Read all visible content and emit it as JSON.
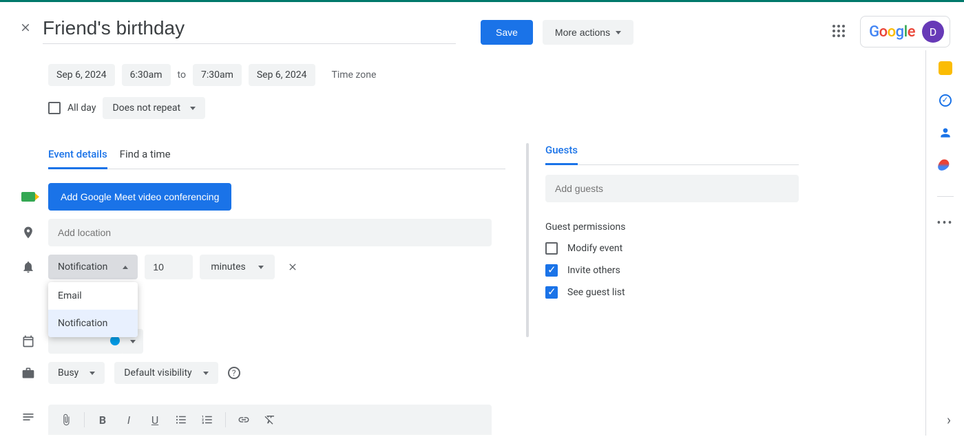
{
  "header": {
    "title": "Friend's birthday",
    "save_label": "Save",
    "more_actions_label": "More actions",
    "avatar_letter": "D"
  },
  "date": {
    "start_date": "Sep 6, 2024",
    "start_time": "6:30am",
    "to_label": "to",
    "end_time": "7:30am",
    "end_date": "Sep 6, 2024",
    "timezone_label": "Time zone"
  },
  "allday": {
    "label": "All day",
    "repeat_label": "Does not repeat"
  },
  "tabs": {
    "event_details": "Event details",
    "find_time": "Find a time"
  },
  "meet_button": "Add Google Meet video conferencing",
  "location_placeholder": "Add location",
  "notification": {
    "type_label": "Notification",
    "value": "10",
    "unit": "minutes",
    "menu_email": "Email",
    "menu_notification": "Notification"
  },
  "availability": {
    "busy": "Busy",
    "visibility": "Default visibility"
  },
  "guests": {
    "tab": "Guests",
    "placeholder": "Add guests",
    "permissions_title": "Guest permissions",
    "modify": "Modify event",
    "invite": "Invite others",
    "see_list": "See guest list"
  }
}
